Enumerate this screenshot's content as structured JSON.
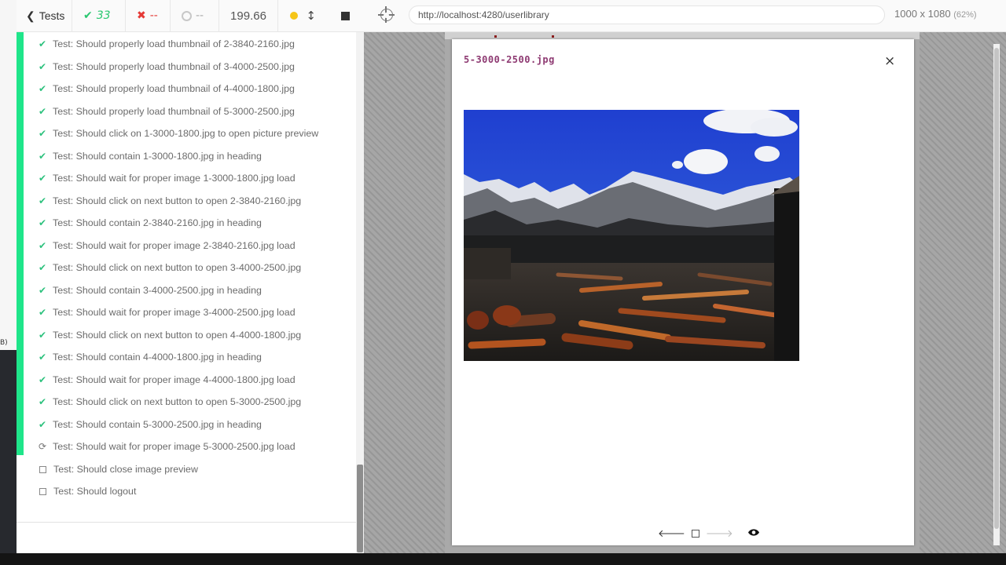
{
  "reporter": {
    "back_label": "Tests",
    "passed_count": "33",
    "failed_count": "--",
    "pending_count": "--",
    "duration": "199.66",
    "tests": [
      {
        "status": "passed",
        "title": "Test: Should properly load thumbnail of 2-3840-2160.jpg"
      },
      {
        "status": "passed",
        "title": "Test: Should properly load thumbnail of 3-4000-2500.jpg"
      },
      {
        "status": "passed",
        "title": "Test: Should properly load thumbnail of 4-4000-1800.jpg"
      },
      {
        "status": "passed",
        "title": "Test: Should properly load thumbnail of 5-3000-2500.jpg"
      },
      {
        "status": "passed",
        "title": "Test: Should click on 1-3000-1800.jpg to open picture preview"
      },
      {
        "status": "passed",
        "title": "Test: Should contain 1-3000-1800.jpg in heading"
      },
      {
        "status": "passed",
        "title": "Test: Should wait for proper image 1-3000-1800.jpg load"
      },
      {
        "status": "passed",
        "title": "Test: Should click on next button to open 2-3840-2160.jpg"
      },
      {
        "status": "passed",
        "title": "Test: Should contain 2-3840-2160.jpg in heading"
      },
      {
        "status": "passed",
        "title": "Test: Should wait for proper image 2-3840-2160.jpg load"
      },
      {
        "status": "passed",
        "title": "Test: Should click on next button to open 3-4000-2500.jpg"
      },
      {
        "status": "passed",
        "title": "Test: Should contain 3-4000-2500.jpg in heading"
      },
      {
        "status": "passed",
        "title": "Test: Should wait for proper image 3-4000-2500.jpg load"
      },
      {
        "status": "passed",
        "title": "Test: Should click on next button to open 4-4000-1800.jpg"
      },
      {
        "status": "passed",
        "title": "Test: Should contain 4-4000-1800.jpg in heading"
      },
      {
        "status": "passed",
        "title": "Test: Should wait for proper image 4-4000-1800.jpg load"
      },
      {
        "status": "passed",
        "title": "Test: Should click on next button to open 5-3000-2500.jpg"
      },
      {
        "status": "passed",
        "title": "Test: Should contain 5-3000-2500.jpg in heading"
      },
      {
        "status": "running",
        "title": "Test: Should wait for proper image 5-3000-2500.jpg load"
      },
      {
        "status": "pending",
        "title": "Test: Should close image preview"
      },
      {
        "status": "pending",
        "title": "Test: Should logout"
      }
    ]
  },
  "aut": {
    "url": "http://localhost:4280/userlibrary",
    "viewport": "1000 x 1080",
    "zoom": "(62%)"
  },
  "preview": {
    "title": "5-3000-2500.jpg",
    "close_label": "×"
  },
  "left_strip_tag": "B)",
  "colors": {
    "pass": "#1fe58a",
    "fail": "#e53935",
    "title_accent": "#8e3a72"
  }
}
